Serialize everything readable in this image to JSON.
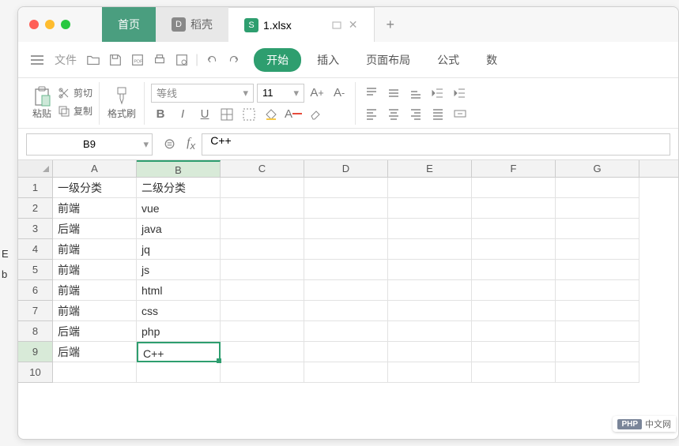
{
  "tabs": {
    "home": "首页",
    "doc": "稻壳",
    "file": "1.xlsx"
  },
  "menu": {
    "file": "文件",
    "start": "开始",
    "insert": "插入",
    "layout": "页面布局",
    "formula": "公式",
    "data": "数"
  },
  "clipboard": {
    "cut": "剪切",
    "copy": "复制",
    "paste": "粘贴",
    "brush": "格式刷"
  },
  "font": {
    "name": "等线",
    "size": "11"
  },
  "cellref": {
    "name": "B9",
    "formula": "C++"
  },
  "columns": [
    "A",
    "B",
    "C",
    "D",
    "E",
    "F",
    "G"
  ],
  "rows": [
    {
      "n": "1",
      "a": "一级分类",
      "b": "二级分类"
    },
    {
      "n": "2",
      "a": "前端",
      "b": "vue"
    },
    {
      "n": "3",
      "a": "后端",
      "b": "java"
    },
    {
      "n": "4",
      "a": "前端",
      "b": "jq"
    },
    {
      "n": "5",
      "a": "前端",
      "b": "js"
    },
    {
      "n": "6",
      "a": "前端",
      "b": "html"
    },
    {
      "n": "7",
      "a": "前端",
      "b": "css"
    },
    {
      "n": "8",
      "a": "后端",
      "b": "php"
    },
    {
      "n": "9",
      "a": "后端",
      "b": "C++"
    },
    {
      "n": "10",
      "a": "",
      "b": ""
    }
  ],
  "watermark": {
    "badge": "PHP",
    "text": "中文网"
  },
  "edge": {
    "e": "E",
    "b": "b"
  }
}
